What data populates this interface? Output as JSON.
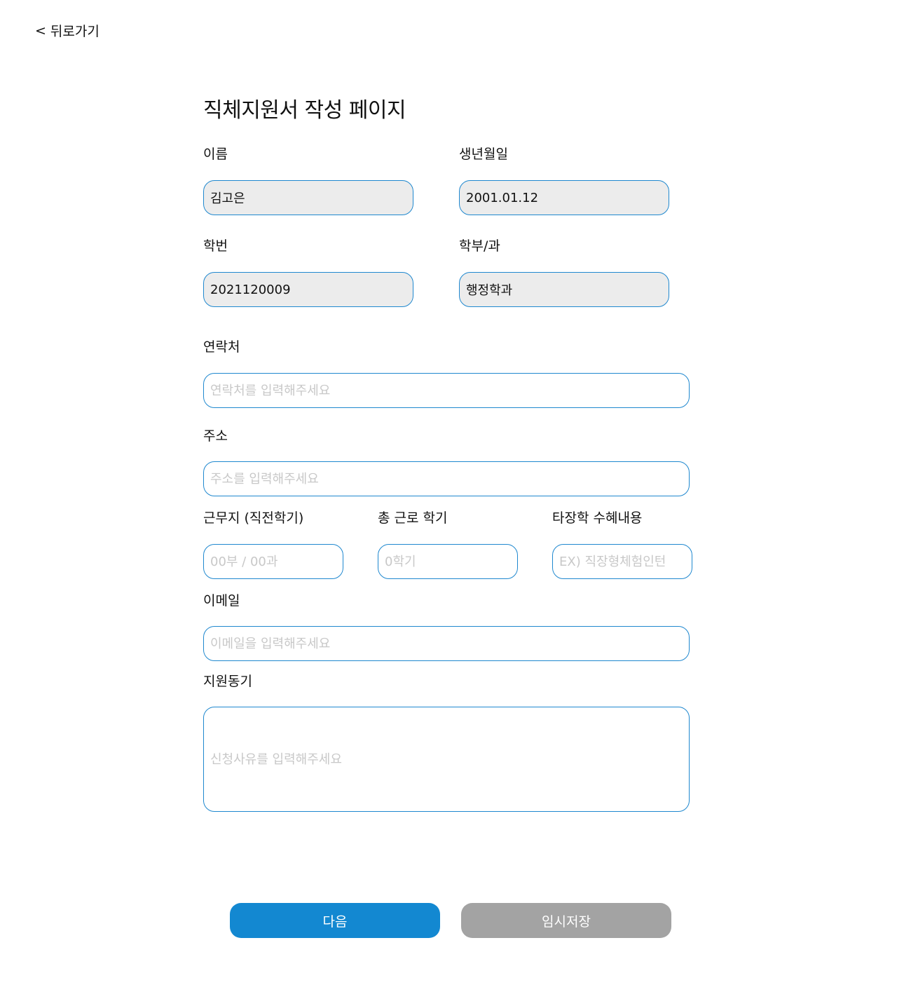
{
  "nav": {
    "back_icon": "<",
    "back_label": "뒤로가기"
  },
  "page": {
    "title": "직체지원서 작성 페이지"
  },
  "form": {
    "name": {
      "label": "이름",
      "value": "김고은"
    },
    "birthdate": {
      "label": "생년월일",
      "value": "2001.01.12"
    },
    "student_id": {
      "label": "학번",
      "value": "2021120009"
    },
    "department": {
      "label": "학부/과",
      "value": "행정학과"
    },
    "contact": {
      "label": "연락처",
      "placeholder": "연락처를 입력해주세요"
    },
    "address": {
      "label": "주소",
      "placeholder": "주소를 입력해주세요"
    },
    "workplace": {
      "label": "근무지 (직전학기)",
      "placeholder": "00부 / 00과"
    },
    "total_semesters": {
      "label": "총 근로 학기",
      "placeholder": "0학기"
    },
    "other_benefits": {
      "label": "타장학 수혜내용",
      "placeholder": "EX) 직장형체험인턴"
    },
    "email": {
      "label": "이메일",
      "placeholder": "이메일을 입력해주세요"
    },
    "motivation": {
      "label": "지원동기",
      "placeholder": "신청사유를 입력해주세요"
    }
  },
  "actions": {
    "next_label": "다음",
    "save_label": "임시저장"
  },
  "colors": {
    "accent": "#1388d1",
    "border": "#1f88cf",
    "secondary_button": "#a3a3a3",
    "filled_field": "#ececec",
    "placeholder": "#c8c8c8"
  }
}
